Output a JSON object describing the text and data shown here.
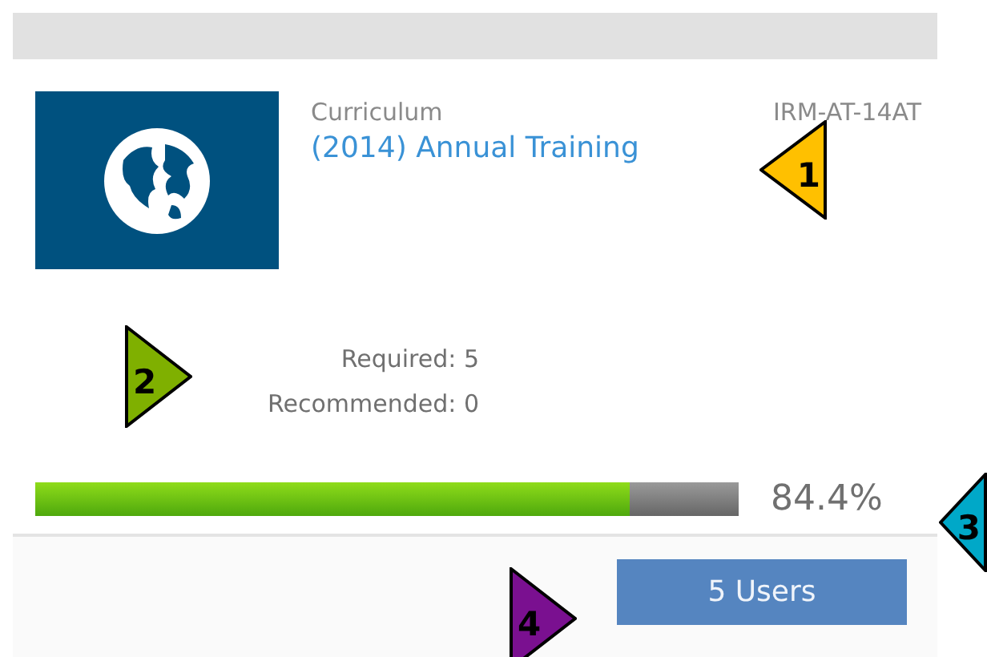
{
  "card": {
    "type_label": "Curriculum",
    "code": "IRM-AT-14AT",
    "title": "(2014) Annual Training",
    "counts": [
      "Required: 5",
      "Recommended: 0"
    ],
    "progress": {
      "level": 0.844,
      "reading": "84.4%"
    },
    "users_button": "5 Users"
  },
  "callouts": [
    {
      "label": "1",
      "color": "#ffc000",
      "kind": "point-left"
    },
    {
      "label": "2",
      "color": "#7fb000",
      "kind": "point-right"
    },
    {
      "label": "3",
      "color": "#00a8c8",
      "kind": "point-left"
    },
    {
      "label": "4",
      "color": "#7a1090",
      "kind": "point-right"
    }
  ]
}
